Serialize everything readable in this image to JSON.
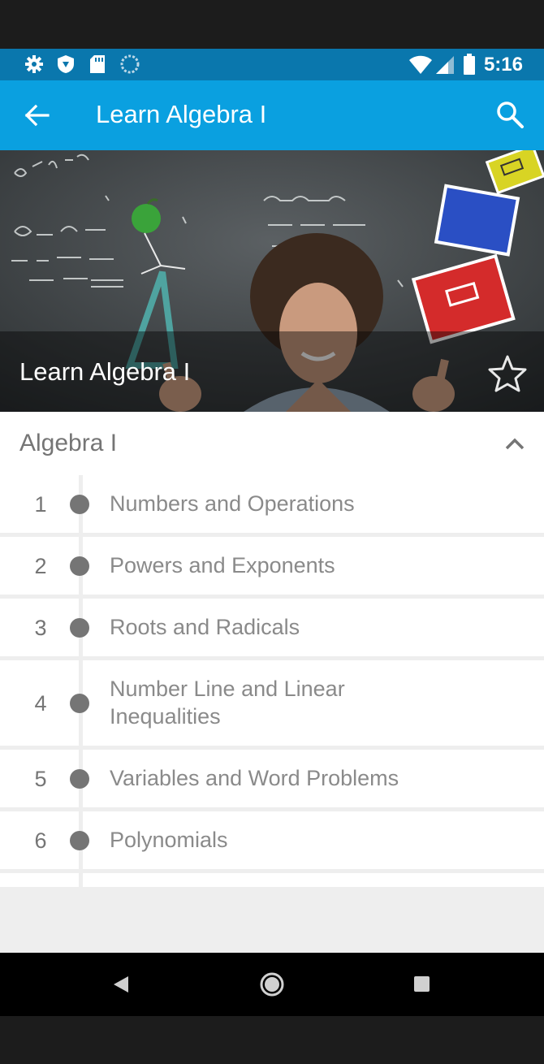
{
  "status_bar": {
    "time": "5:16",
    "icons": [
      "settings-icon",
      "shield-icon",
      "sd-card-icon",
      "sync-icon",
      "wifi-icon",
      "cell-signal-icon",
      "battery-icon"
    ]
  },
  "app_bar": {
    "title": "Learn Algebra I",
    "back_icon": "arrow-back-icon",
    "search_icon": "search-icon"
  },
  "hero": {
    "title": "Learn Algebra I",
    "favorite_icon": "star-outline-icon"
  },
  "section": {
    "title": "Algebra I",
    "expand_icon": "chevron-up-icon"
  },
  "topics": [
    {
      "number": "1",
      "title": "Numbers and Operations"
    },
    {
      "number": "2",
      "title": "Powers and Exponents"
    },
    {
      "number": "3",
      "title": "Roots and Radicals"
    },
    {
      "number": "4",
      "title": "Number Line and Linear Inequalities"
    },
    {
      "number": "5",
      "title": "Variables and Word Problems"
    },
    {
      "number": "6",
      "title": "Polynomials"
    }
  ],
  "nav_bar": {
    "icons": [
      "nav-back-icon",
      "nav-home-icon",
      "nav-recents-icon"
    ]
  },
  "colors": {
    "status_bar": "#0a77ad",
    "app_bar": "#0aa0e0",
    "text_secondary": "#757575"
  }
}
